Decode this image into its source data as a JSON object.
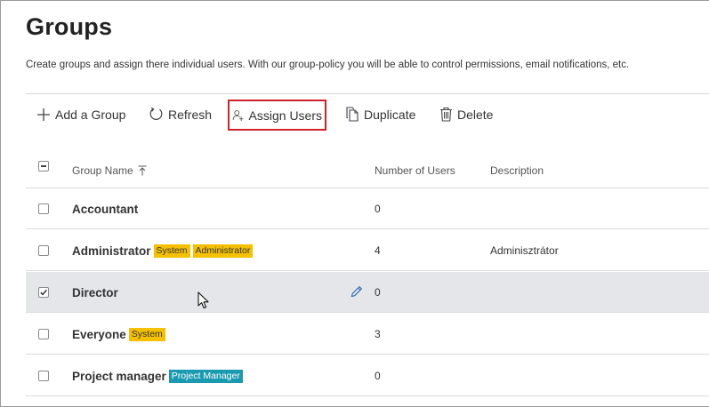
{
  "page": {
    "title": "Groups",
    "subtitle": "Create groups and assign there individual users. With our group-policy you will be able to control permissions, email notifications, etc."
  },
  "toolbar": {
    "add_label": "Add a Group",
    "refresh_label": "Refresh",
    "assign_label": "Assign Users",
    "duplicate_label": "Duplicate",
    "delete_label": "Delete"
  },
  "table": {
    "headers": {
      "name": "Group Name",
      "users": "Number of Users",
      "description": "Description"
    },
    "rows": [
      {
        "name": "Accountant",
        "badges": [],
        "users": "0",
        "description": "",
        "checked": false
      },
      {
        "name": "Administrator",
        "badges": [
          "System",
          "Administrator"
        ],
        "users": "4",
        "description": "Adminisztrátor",
        "checked": false
      },
      {
        "name": "Director",
        "badges": [],
        "users": "0",
        "description": "",
        "checked": true
      },
      {
        "name": "Everyone",
        "badges": [
          "System"
        ],
        "users": "3",
        "description": "",
        "checked": false
      },
      {
        "name": "Project manager",
        "badges": [
          "Project Manager"
        ],
        "users": "0",
        "description": "",
        "checked": false
      }
    ]
  },
  "colors": {
    "badge_yellow": "#f5c000",
    "badge_teal": "#1a9ab0",
    "highlight_border": "#d0202a",
    "selected_row": "#e4e6ea"
  },
  "icons": {
    "add": "plus-icon",
    "refresh": "refresh-icon",
    "assign": "user-add-icon",
    "duplicate": "duplicate-icon",
    "delete": "trash-icon",
    "sort": "sort-ascending-icon",
    "edit": "pencil-icon",
    "cursor": "mouse-pointer-icon"
  }
}
